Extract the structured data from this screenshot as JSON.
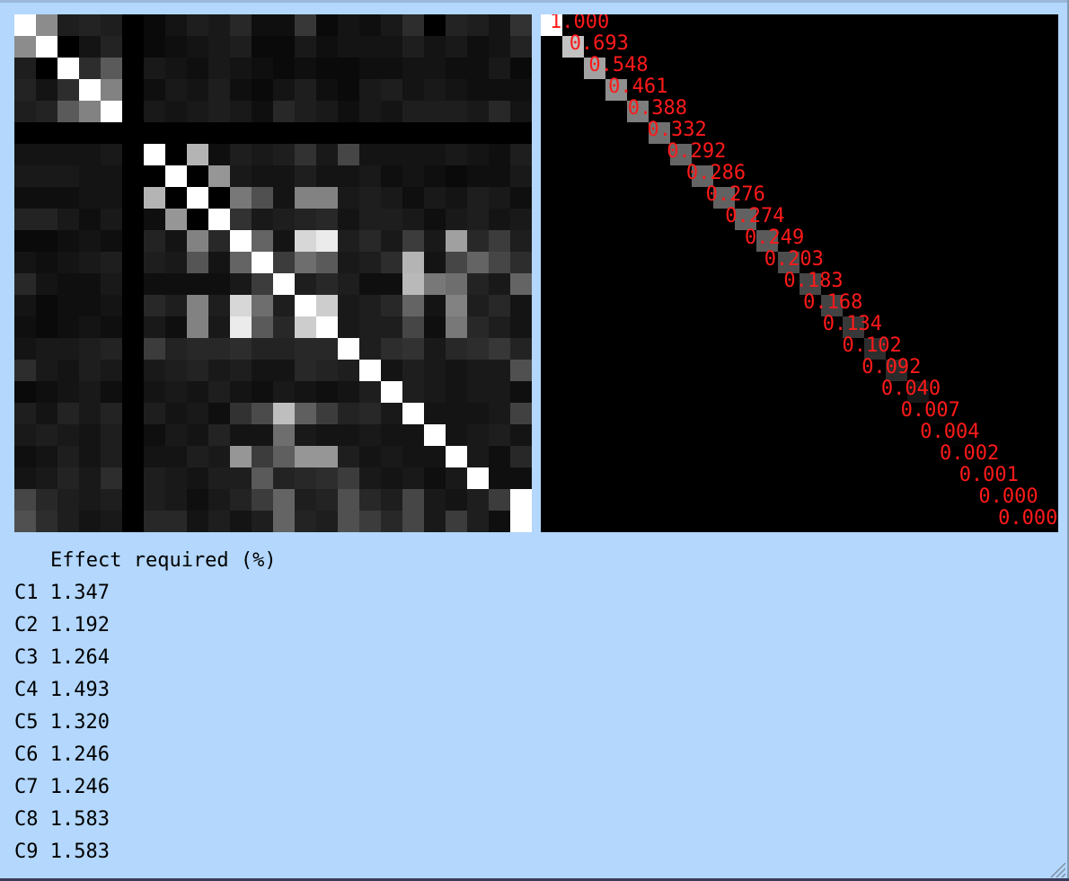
{
  "correlation_matrix": {
    "size": 24,
    "gray": [
      [
        255,
        140,
        30,
        35,
        30,
        0,
        10,
        20,
        30,
        25,
        40,
        15,
        15,
        55,
        10,
        20,
        15,
        25,
        45,
        0,
        35,
        30,
        20,
        50
      ],
      [
        140,
        255,
        0,
        20,
        35,
        0,
        10,
        15,
        20,
        25,
        30,
        10,
        10,
        25,
        15,
        20,
        20,
        20,
        30,
        20,
        25,
        15,
        20,
        35
      ],
      [
        30,
        0,
        255,
        45,
        90,
        0,
        25,
        20,
        15,
        25,
        20,
        15,
        10,
        15,
        10,
        10,
        15,
        15,
        20,
        20,
        15,
        15,
        25,
        10
      ],
      [
        35,
        20,
        45,
        255,
        130,
        0,
        15,
        25,
        20,
        30,
        15,
        10,
        20,
        30,
        15,
        10,
        25,
        30,
        20,
        25,
        20,
        15,
        15,
        15
      ],
      [
        30,
        35,
        90,
        130,
        255,
        0,
        25,
        20,
        25,
        30,
        25,
        15,
        40,
        30,
        25,
        15,
        25,
        20,
        30,
        30,
        30,
        25,
        40,
        20
      ],
      [
        0,
        0,
        0,
        0,
        0,
        0,
        0,
        0,
        0,
        0,
        0,
        0,
        0,
        0,
        0,
        0,
        0,
        0,
        0,
        0,
        0,
        0,
        0,
        0
      ],
      [
        20,
        20,
        20,
        20,
        25,
        0,
        255,
        0,
        180,
        15,
        30,
        25,
        30,
        50,
        25,
        70,
        20,
        20,
        20,
        20,
        25,
        20,
        15,
        30
      ],
      [
        25,
        25,
        25,
        20,
        20,
        0,
        0,
        255,
        0,
        150,
        25,
        20,
        20,
        30,
        20,
        20,
        25,
        15,
        20,
        15,
        10,
        15,
        15,
        25
      ],
      [
        15,
        15,
        15,
        20,
        20,
        0,
        180,
        0,
        255,
        0,
        120,
        80,
        20,
        130,
        130,
        25,
        30,
        25,
        15,
        25,
        20,
        30,
        25,
        15
      ],
      [
        35,
        35,
        25,
        15,
        25,
        0,
        15,
        150,
        0,
        255,
        50,
        25,
        30,
        35,
        40,
        20,
        30,
        30,
        25,
        15,
        25,
        30,
        20,
        25
      ],
      [
        10,
        10,
        15,
        20,
        15,
        0,
        35,
        20,
        130,
        40,
        255,
        100,
        20,
        215,
        235,
        30,
        40,
        25,
        60,
        25,
        160,
        40,
        60,
        30
      ],
      [
        20,
        15,
        20,
        25,
        30,
        0,
        30,
        25,
        85,
        20,
        100,
        255,
        60,
        110,
        90,
        25,
        30,
        45,
        180,
        20,
        70,
        100,
        70,
        45
      ],
      [
        40,
        20,
        15,
        15,
        25,
        0,
        15,
        15,
        15,
        15,
        25,
        60,
        255,
        30,
        40,
        30,
        15,
        15,
        185,
        120,
        110,
        35,
        25,
        100
      ],
      [
        20,
        10,
        15,
        15,
        20,
        0,
        40,
        30,
        130,
        30,
        215,
        110,
        30,
        255,
        205,
        25,
        30,
        40,
        100,
        20,
        130,
        30,
        40,
        20
      ],
      [
        15,
        10,
        15,
        20,
        15,
        0,
        25,
        15,
        130,
        25,
        235,
        90,
        40,
        205,
        255,
        25,
        30,
        30,
        70,
        15,
        120,
        40,
        30,
        20
      ],
      [
        20,
        25,
        25,
        30,
        35,
        0,
        60,
        35,
        40,
        40,
        45,
        35,
        35,
        40,
        40,
        255,
        30,
        45,
        50,
        25,
        40,
        45,
        55,
        35
      ],
      [
        45,
        25,
        20,
        30,
        25,
        0,
        25,
        30,
        35,
        25,
        30,
        20,
        20,
        40,
        35,
        30,
        255,
        20,
        30,
        25,
        20,
        25,
        25,
        80
      ],
      [
        10,
        15,
        20,
        25,
        15,
        0,
        20,
        25,
        20,
        30,
        20,
        15,
        25,
        20,
        15,
        20,
        30,
        255,
        30,
        25,
        20,
        25,
        25,
        15
      ],
      [
        30,
        20,
        35,
        25,
        35,
        0,
        30,
        20,
        25,
        15,
        50,
        75,
        190,
        95,
        60,
        35,
        40,
        25,
        255,
        20,
        20,
        20,
        25,
        65
      ],
      [
        25,
        30,
        25,
        20,
        30,
        0,
        15,
        25,
        20,
        35,
        20,
        20,
        110,
        25,
        20,
        20,
        25,
        20,
        20,
        255,
        20,
        25,
        30,
        20
      ],
      [
        15,
        20,
        30,
        20,
        30,
        0,
        20,
        20,
        30,
        25,
        150,
        60,
        95,
        150,
        150,
        30,
        20,
        25,
        20,
        20,
        255,
        25,
        15,
        40
      ],
      [
        20,
        25,
        35,
        25,
        45,
        0,
        30,
        25,
        20,
        30,
        30,
        90,
        35,
        40,
        45,
        60,
        25,
        20,
        25,
        15,
        25,
        255,
        15,
        15
      ],
      [
        70,
        40,
        30,
        25,
        30,
        0,
        30,
        25,
        15,
        25,
        35,
        60,
        100,
        30,
        35,
        80,
        40,
        30,
        70,
        25,
        20,
        30,
        60,
        255
      ],
      [
        80,
        45,
        30,
        20,
        25,
        0,
        40,
        40,
        20,
        30,
        20,
        30,
        100,
        35,
        30,
        80,
        60,
        40,
        70,
        25,
        60,
        30,
        15,
        255
      ]
    ]
  },
  "eigenvalues": {
    "labels": [
      "1.000",
      "0.693",
      "0.548",
      "0.461",
      "0.388",
      "0.332",
      "0.292",
      "0.286",
      "0.276",
      "0.274",
      "0.249",
      "0.203",
      "0.183",
      "0.168",
      "0.134",
      "0.102",
      "0.092",
      "0.040",
      "0.007",
      "0.004",
      "0.002",
      "0.001",
      "0.000",
      "0.000"
    ],
    "values": [
      1.0,
      0.693,
      0.548,
      0.461,
      0.388,
      0.332,
      0.292,
      0.286,
      0.276,
      0.274,
      0.249,
      0.203,
      0.183,
      0.168,
      0.134,
      0.102,
      0.092,
      0.04,
      0.007,
      0.004,
      0.002,
      0.001,
      0.0,
      0.0
    ],
    "label_color": "#ff1a1a"
  },
  "results": {
    "header": "Effect required (%)",
    "rows": [
      {
        "id": "C1",
        "value": "1.347"
      },
      {
        "id": "C2",
        "value": "1.192"
      },
      {
        "id": "C3",
        "value": "1.264"
      },
      {
        "id": "C4",
        "value": "1.493"
      },
      {
        "id": "C5",
        "value": "1.320"
      },
      {
        "id": "C6",
        "value": "1.246"
      },
      {
        "id": "C7",
        "value": "1.246"
      },
      {
        "id": "C8",
        "value": "1.583"
      },
      {
        "id": "C9",
        "value": "1.583"
      }
    ]
  },
  "icons": {
    "resize_grip": "resize-grip-icon"
  },
  "colors": {
    "background": "#b3d7fd",
    "panel": "#000000"
  }
}
